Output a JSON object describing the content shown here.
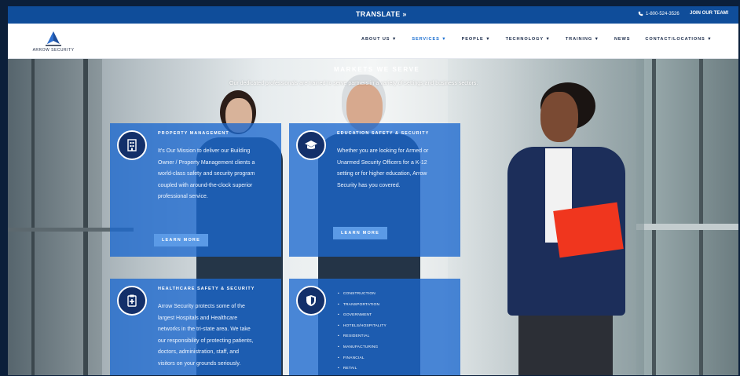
{
  "topbar": {
    "translate": "TRANSLATE »",
    "phone": "1-800-524-3526",
    "join": "JOIN OUR TEAM!"
  },
  "logo": {
    "text": "ARROW SECURITY"
  },
  "nav": {
    "items": [
      "ABOUT US ▼",
      "SERVICES ▼",
      "PEOPLE ▼",
      "TECHNOLOGY ▼",
      "TRAINING ▼",
      "NEWS",
      "CONTACT/LOCATIONS ▼"
    ],
    "active": "SERVICES ▼"
  },
  "hero": {
    "title": "MARKETS WE SERVE",
    "subtitle": "Our dedicated professionals are trained to serve partners in a variety of settings and business sectors."
  },
  "cards": {
    "property": {
      "title": "PROPERTY MANAGEMENT",
      "lines": [
        "It's Our Mission to deliver our Building",
        "Owner / Property Management clients a",
        "world-class safety and security program",
        "coupled with around-the-clock superior",
        "professional service."
      ],
      "button": "LEARN MORE"
    },
    "education": {
      "title": "EDUCATION SAFETY & SECURITY",
      "lines": [
        "Whether you are looking for Armed or",
        "Unarmed Security Officers for a K-12",
        "setting or for higher education, Arrow",
        "Security has you covered."
      ],
      "button": "LEARN MORE"
    },
    "healthcare": {
      "title": "HEALTHCARE SAFETY & SECURITY",
      "lines": [
        "Arrow Security protects some of the",
        "largest Hospitals and Healthcare",
        "networks in the tri-state area. We take",
        "our responsibility of protecting patients,",
        "doctors, administration, staff, and",
        "visitors on your grounds seriously."
      ]
    },
    "markets": {
      "items": [
        "CONSTRUCTION",
        "TRANSPORTATION",
        "GOVERNMENT",
        "HOTELS/HOSPITALITY",
        "RESIDENTIAL",
        "MANUFACTURING",
        "FINANCIAL",
        "RETAIL"
      ]
    }
  },
  "colors": {
    "topbar": "#0f4d9a",
    "accent": "#1b6fd1",
    "card": "#1b68ce",
    "icon_circle": "#13306a"
  },
  "icons": {
    "property": "building-icon",
    "education": "graduation-cap-icon",
    "healthcare": "clipboard-icon",
    "markets": "shield-icon",
    "phone": "phone-icon"
  }
}
